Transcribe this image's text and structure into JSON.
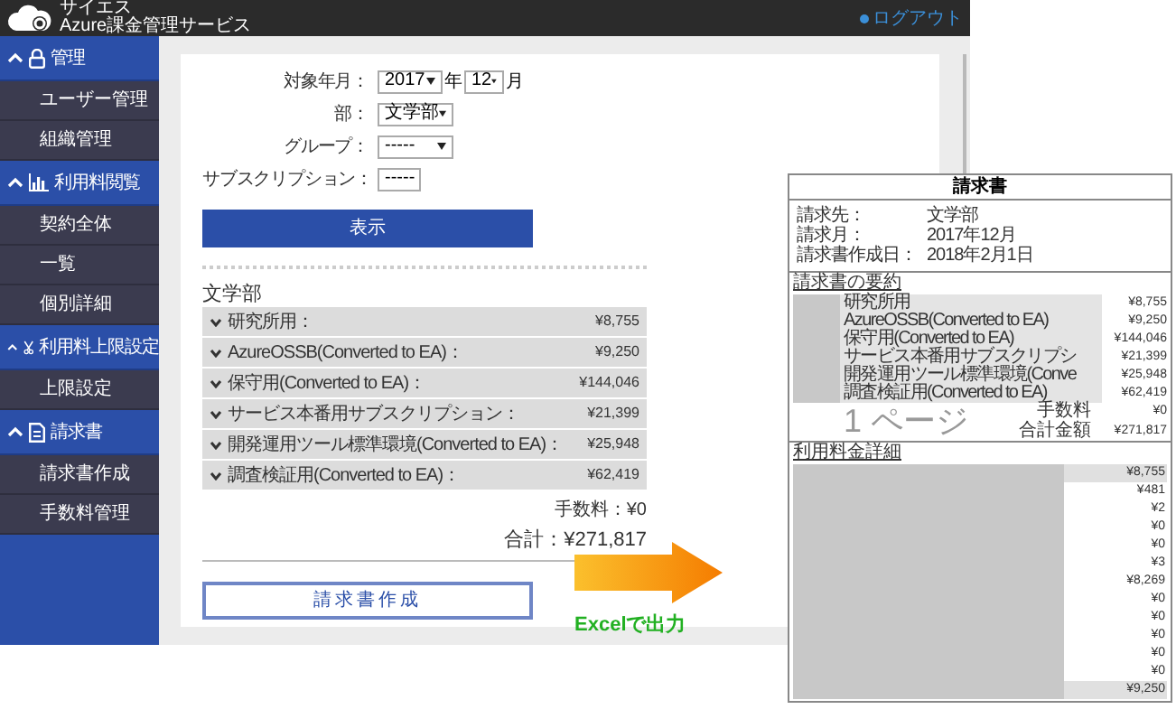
{
  "header": {
    "brand_small": "サイエス",
    "brand": "Azure課金管理サービス",
    "logout": "ログアウト"
  },
  "sidebar": {
    "sections": [
      {
        "label": "管理",
        "expanded": true,
        "items": [
          "ユーザー管理",
          "組織管理"
        ]
      },
      {
        "label": "利用料閲覧",
        "expanded": true,
        "items": [
          "契約全体",
          "一覧",
          "個別詳細"
        ]
      },
      {
        "label": "利用料上限設定",
        "expanded": true,
        "items": [
          "上限設定"
        ]
      },
      {
        "label": "請求書",
        "expanded": true,
        "items": [
          "請求書作成",
          "手数料管理"
        ]
      }
    ]
  },
  "filter": {
    "fields": [
      {
        "kind": "year_month",
        "label": "対象年月：",
        "year": "2017",
        "year_unit": "年",
        "month": "12",
        "month_unit": "月"
      },
      {
        "kind": "select",
        "label": "部：",
        "value": "文学部"
      },
      {
        "kind": "select",
        "label": "グループ：",
        "value": "-----"
      },
      {
        "kind": "small_select",
        "label": "サブスクリプション：",
        "value": "-----"
      }
    ],
    "button": "表示"
  },
  "summary": {
    "title": "文学部",
    "rows": [
      {
        "label": "研究所用：",
        "amount": "¥8,755"
      },
      {
        "label": "AzureOSSB(Converted to EA)：",
        "amount": "¥9,250"
      },
      {
        "label": "保守用(Converted to EA)：",
        "amount": "¥144,046"
      },
      {
        "label": "サービス本番用サブスクリプション：",
        "amount": "¥21,399"
      },
      {
        "label": "開発運用ツール標準環境(Converted to EA)：",
        "amount": "¥25,948"
      },
      {
        "label": "調査検証用(Converted to EA)：",
        "amount": "¥62,419"
      }
    ],
    "fee": "手数料：¥0",
    "total": "合計：¥271,817",
    "button": "請求書作成"
  },
  "callout": {
    "label": "Excelで出力"
  },
  "invoice": {
    "title": "請求書",
    "info": [
      {
        "label": "請求先：",
        "value": "文学部"
      },
      {
        "label": "請求月：",
        "value": "2017年12月"
      },
      {
        "label": "請求書作成日：",
        "value": "2018年2月1日"
      }
    ],
    "summary_heading": "請求書の要約",
    "summary_rows": [
      {
        "label": "研究所用",
        "amount": "¥8,755"
      },
      {
        "label": "AzureOSSB(Converted to EA)",
        "amount": "¥9,250"
      },
      {
        "label": "保守用(Converted to EA)",
        "amount": "¥144,046"
      },
      {
        "label": "サービス本番用サブスクリプシ",
        "amount": "¥21,399"
      },
      {
        "label": "開発運用ツール標準環境(Conve",
        "amount": "¥25,948"
      },
      {
        "label": "調査検証用(Converted to EA)",
        "amount": "¥62,419"
      }
    ],
    "page_label": "1 ページ",
    "fee_label": "手数料",
    "fee": "¥0",
    "total_label": "合計金額",
    "total": "¥271,817",
    "detail_heading": "利用料金詳細",
    "detail_rows": [
      {
        "amount": "¥8,755",
        "highlighted": true
      },
      {
        "amount": "¥481",
        "highlighted": false
      },
      {
        "amount": "¥2",
        "highlighted": false
      },
      {
        "amount": "¥0",
        "highlighted": false
      },
      {
        "amount": "¥0",
        "highlighted": false
      },
      {
        "amount": "¥3",
        "highlighted": false
      },
      {
        "amount": "¥8,269",
        "highlighted": false
      },
      {
        "amount": "¥0",
        "highlighted": false
      },
      {
        "amount": "¥0",
        "highlighted": false
      },
      {
        "amount": "¥0",
        "highlighted": false
      },
      {
        "amount": "¥0",
        "highlighted": false
      },
      {
        "amount": "¥0",
        "highlighted": false
      },
      {
        "amount": "¥9,250",
        "highlighted": true
      }
    ]
  }
}
